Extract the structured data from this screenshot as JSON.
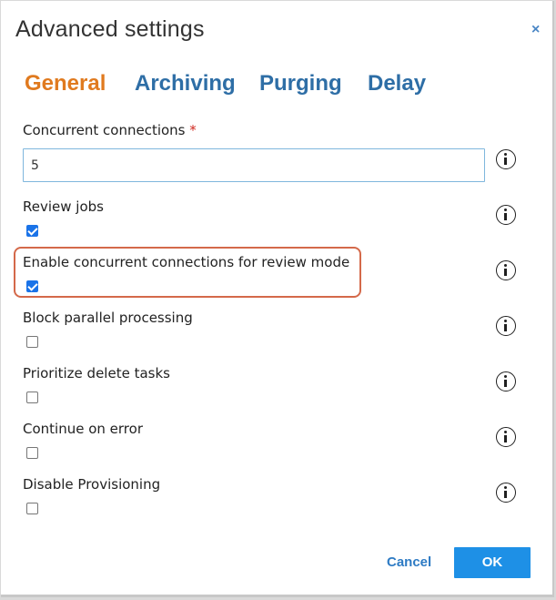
{
  "dialog": {
    "title": "Advanced settings",
    "close_glyph": "×"
  },
  "tabs": [
    {
      "label": "General",
      "active": true
    },
    {
      "label": "Archiving",
      "active": false
    },
    {
      "label": "Purging",
      "active": false
    },
    {
      "label": "Delay",
      "active": false
    }
  ],
  "fields": {
    "concurrent_connections": {
      "label": "Concurrent connections",
      "required_mark": "*",
      "value": "5"
    },
    "review_jobs": {
      "label": "Review jobs",
      "checked": true
    },
    "enable_concurrent_review": {
      "label": "Enable concurrent connections for review mode",
      "checked": true
    },
    "block_parallel": {
      "label": "Block parallel processing",
      "checked": false
    },
    "prioritize_delete": {
      "label": "Prioritize delete tasks",
      "checked": false
    },
    "continue_on_error": {
      "label": "Continue on error",
      "checked": false
    },
    "disable_provisioning": {
      "label": "Disable Provisioning",
      "checked": false
    }
  },
  "footer": {
    "cancel_label": "Cancel",
    "ok_label": "OK"
  },
  "colors": {
    "active_tab": "#e07a1f",
    "inactive_tab": "#2e6ea6",
    "primary_button": "#1e90e6",
    "highlight_border": "#d4694a",
    "required": "#d0281f"
  },
  "icons": {
    "info": "info-circle-icon",
    "close": "close-icon"
  }
}
